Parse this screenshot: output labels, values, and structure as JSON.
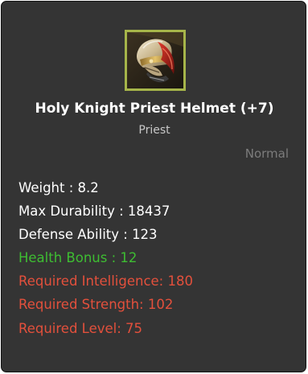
{
  "item": {
    "icon": "holy-knight-priest-helmet-icon",
    "name": "Holy Knight Priest Helmet (+7)",
    "class": "Priest",
    "grade": "Normal"
  },
  "stats": {
    "weight": "Weight : 8.2",
    "max_durability": "Max Durability : 18437",
    "defense": "Defense Ability : 123",
    "health_bonus": "Health Bonus : 12",
    "req_intelligence": "Required Intelligence: 180",
    "req_strength": "Required Strength: 102",
    "req_level": "Required Level: 75"
  },
  "colors": {
    "panel_background": "#343434",
    "icon_border": "#a6b54a",
    "normal_stat": "#ffffff",
    "bonus_stat": "#3ebd32",
    "requirement_unmet": "#e3503c",
    "grade_text": "#7c7c7c"
  }
}
